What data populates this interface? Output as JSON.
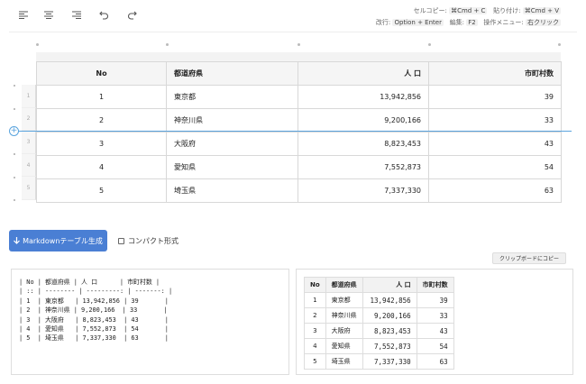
{
  "toolbar": {
    "icons": [
      "align-left-icon",
      "align-center-icon",
      "align-right-icon",
      "undo-icon",
      "redo-icon"
    ]
  },
  "shortcuts": {
    "copy_label": "セルコピー:",
    "copy_key": "⌘Cmd + C",
    "paste_label": "貼り付け:",
    "paste_key": "⌘Cmd + V",
    "newline_label": "改行:",
    "newline_key": "Option + Enter",
    "edit_label": "編集:",
    "edit_key": "F2",
    "menu_label": "操作メニュー:",
    "menu_key": "右クリック"
  },
  "grid": {
    "headers": [
      "No",
      "都道府県",
      "人 口",
      "市町村数"
    ],
    "row_numbers": [
      "1",
      "2",
      "3",
      "4",
      "5"
    ],
    "rows": [
      [
        "1",
        "東京都",
        "13,942,856",
        "39"
      ],
      [
        "2",
        "神奈川県",
        "9,200,166",
        "33"
      ],
      [
        "3",
        "大阪府",
        "8,823,453",
        "43"
      ],
      [
        "4",
        "愛知県",
        "7,552,873",
        "54"
      ],
      [
        "5",
        "埼玉県",
        "7,337,330",
        "63"
      ]
    ]
  },
  "controls": {
    "generate_label": "Markdownテーブル生成",
    "compact_label": "コンパクト形式",
    "compact_checked": false,
    "copy_label": "クリップボードにコピー"
  },
  "markdown_output": "| No | 都道府県 | 人 口      | 市町村数 |\n| :: | -------- | ---------: | -------: |\n| 1  | 東京都   | 13,942,856 | 39       |\n| 2  | 神奈川県 | 9,200,166  | 33       |\n| 3  | 大阪府   | 8,823,453  | 43       |\n| 4  | 愛知県   | 7,552,873  | 54       |\n| 5  | 埼玉県   | 7,337,330  | 63       |",
  "colors": {
    "accent": "#4a7fd4",
    "insert_line": "#5aa4de"
  }
}
